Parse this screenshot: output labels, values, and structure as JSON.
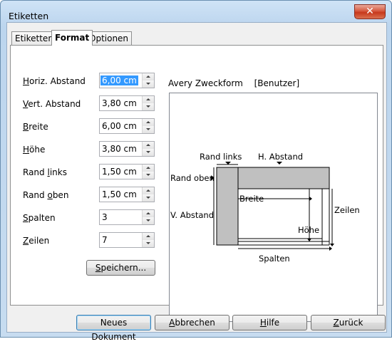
{
  "window": {
    "title": "Etiketten",
    "close_label": "✕"
  },
  "tabs": [
    {
      "label": "Etiketten",
      "active": false
    },
    {
      "label": "Format",
      "active": true
    },
    {
      "label": "Optionen",
      "active": false
    }
  ],
  "fields": [
    {
      "accel": "H",
      "label_rest": "oriz. Abstand",
      "value": "6,00 cm",
      "selected": true
    },
    {
      "accel": "V",
      "label_rest": "ert. Abstand",
      "value": "3,80 cm"
    },
    {
      "accel": "B",
      "label_rest": "reite",
      "value": "6,00 cm"
    },
    {
      "accel": "H",
      "label_rest": "öhe",
      "value": "3,80 cm"
    },
    {
      "label_pre": "Rand ",
      "accel": "l",
      "label_rest": "inks",
      "value": "1,50 cm"
    },
    {
      "label_pre": "Rand ",
      "accel": "o",
      "label_rest": "ben",
      "value": "1,50 cm"
    },
    {
      "accel": "S",
      "label_rest": "palten",
      "value": "3"
    },
    {
      "accel": "Z",
      "label_rest": "eilen",
      "value": "7"
    }
  ],
  "save_button": {
    "accel": "S",
    "label_rest": "peichern..."
  },
  "preview": {
    "brand": "Avery Zweckform",
    "type": "[Benutzer]",
    "labels": {
      "rand_links": "Rand links",
      "h_abstand": "H. Abstand",
      "rand_oben": "Rand oben",
      "v_abstand": "V. Abstand",
      "breite": "Breite",
      "hoehe": "Höhe",
      "zeilen": "Zeilen",
      "spalten": "Spalten"
    }
  },
  "footer": {
    "new_doc": {
      "label": "Neues Dokument"
    },
    "cancel": {
      "accel": "A",
      "label_rest": "bbrechen"
    },
    "help": {
      "accel": "H",
      "label_rest": "ilfe"
    },
    "back": {
      "accel": "Z",
      "label_rest": "urück"
    }
  }
}
